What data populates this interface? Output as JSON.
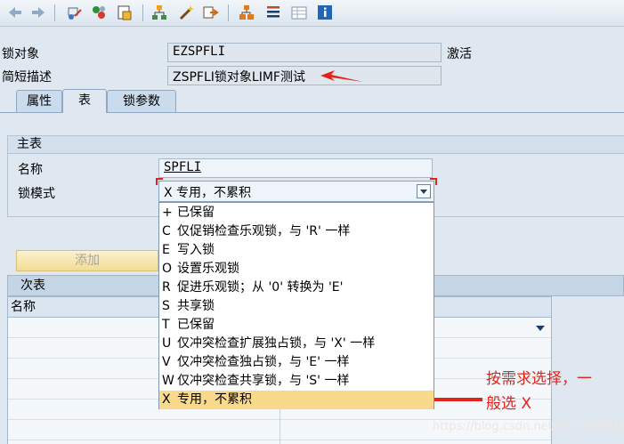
{
  "toolbar": {
    "icons": [
      "back-arrow-icon",
      "forward-arrow-icon",
      "other-object-icon",
      "display-change-icon",
      "activate-icon",
      "check-icon",
      "hierarchy-icon",
      "magic-wand-icon",
      "navigate-icon",
      "grid-layout-icon",
      "list-icon",
      "info-icon"
    ]
  },
  "header": {
    "lock_object_label": "锁对象",
    "lock_object_value": "EZSPFLI",
    "status": "激活",
    "short_desc_label": "简短描述",
    "short_desc_value": "ZSPFLI锁对象LIMF测试"
  },
  "tabs": [
    {
      "label": "属性"
    },
    {
      "label": "表"
    },
    {
      "label": "锁参数"
    }
  ],
  "primary_table": {
    "title": "主表",
    "name_label": "名称",
    "name_value": "SPFLI",
    "lock_mode_label": "锁模式",
    "lock_mode_value": "X 专用，不累积"
  },
  "add_button": "添加",
  "secondary_table": {
    "title": "次表",
    "column_name": "名称"
  },
  "lock_mode_options": [
    {
      "code": "+",
      "text": "已保留"
    },
    {
      "code": "C",
      "text": "仅促销检查乐观锁，与 'R' 一样"
    },
    {
      "code": "E",
      "text": "写入锁"
    },
    {
      "code": "O",
      "text": "设置乐观锁"
    },
    {
      "code": "R",
      "text": "促进乐观锁；从 '0' 转换为 'E'"
    },
    {
      "code": "S",
      "text": "共享锁"
    },
    {
      "code": "T",
      "text": "已保留"
    },
    {
      "code": "U",
      "text": "仅冲突检查扩展独占锁，与 'X' 一样"
    },
    {
      "code": "V",
      "text": "仅冲突检查独占锁，与 'E' 一样"
    },
    {
      "code": "W",
      "text": "仅冲突检查共享锁，与 'S' 一样"
    },
    {
      "code": "X",
      "text": "专用，不累积"
    }
  ],
  "selected_option_index": 10,
  "annotation": {
    "line1": "按需求选择，一",
    "line2": "般选 X",
    "color": "#e2231a"
  },
  "watermark": "https://blog.csdn.net/lmf496891416"
}
